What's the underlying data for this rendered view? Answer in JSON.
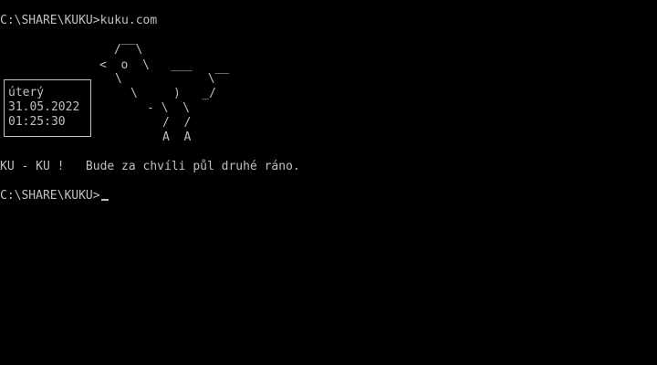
{
  "console": {
    "command_line": "C:\\SHARE\\KUKU>kuku.com",
    "message": "KU - KU !   Bude za chvíli půl druhé ráno.",
    "prompt": "C:\\SHARE\\KUKU>"
  },
  "clock": {
    "day": "úterý",
    "date": "31.05.2022",
    "time": "01:25:30"
  },
  "ascii_art": {
    "row1": "/‾‾\\",
    "row2": "<  o  \\   ___",
    "row3": "\\            \\‾‾",
    "row4": "\\     )   _/",
    "row5": "- \\  \\",
    "row6": "/  /",
    "row7": "A  A"
  },
  "colors": {
    "background": "#000000",
    "text": "#c0c0c0"
  }
}
